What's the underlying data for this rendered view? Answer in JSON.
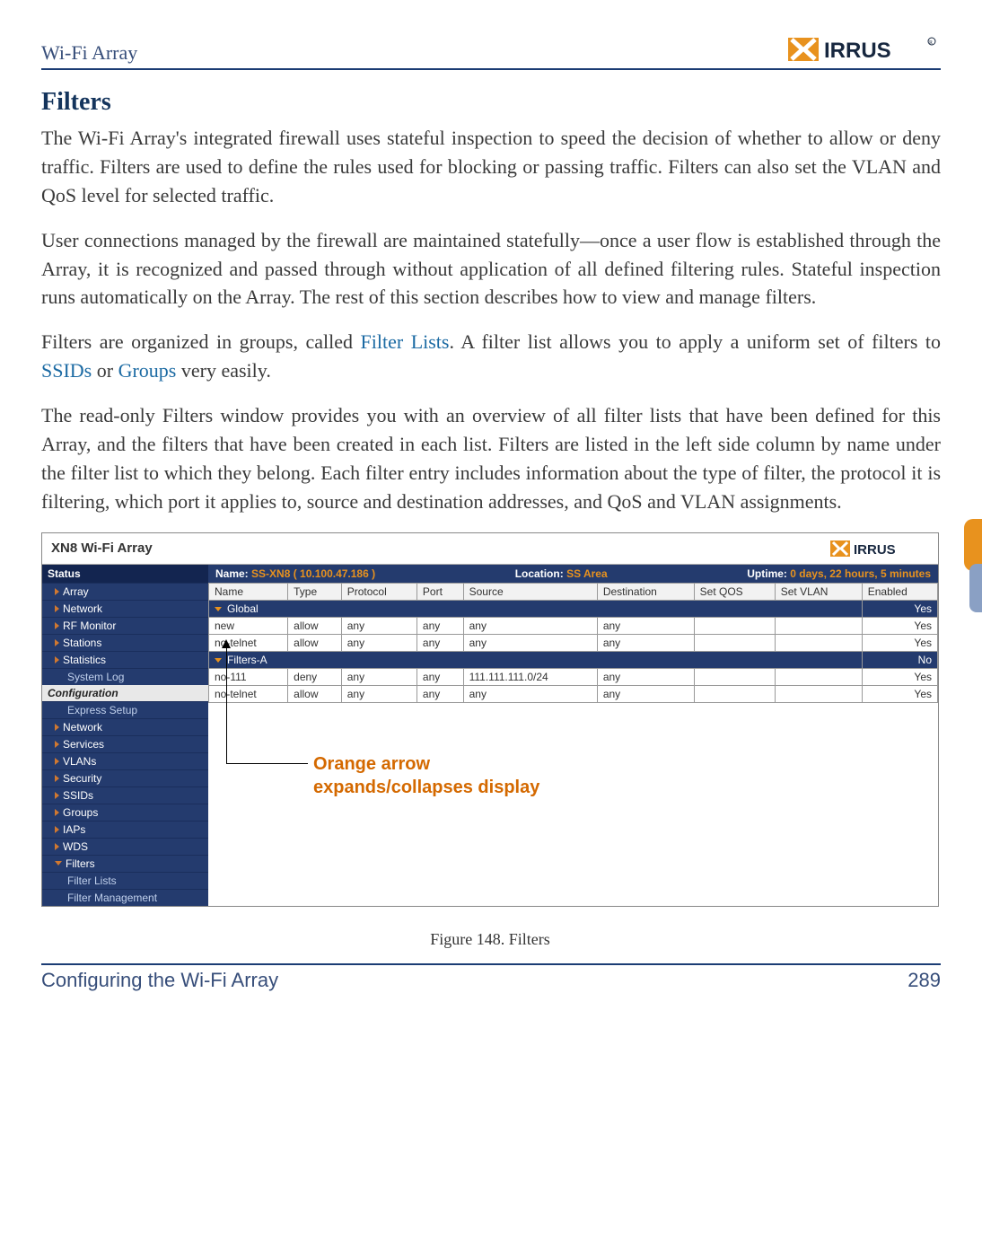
{
  "header": {
    "section": "Wi-Fi Array",
    "logo_text": "XIRRUS"
  },
  "content": {
    "title": "Filters",
    "p1": "The Wi-Fi Array's integrated firewall uses stateful inspection to speed the decision of whether to allow or deny traffic. Filters are used to define the rules used for blocking or passing traffic. Filters can also set the VLAN and QoS level for selected traffic.",
    "p2": "User connections managed by the firewall are maintained statefully—once a user flow is established through the Array, it is recognized and passed through without application of all defined filtering rules. Stateful inspection runs automatically on the Array. The rest of this section describes how to view and manage filters.",
    "p3_a": "Filters are organized in groups, called ",
    "p3_link1": "Filter Lists",
    "p3_b": ". A filter list allows you to apply a uniform set of filters to ",
    "p3_link2": "SSIDs",
    "p3_c": " or ",
    "p3_link3": "Groups",
    "p3_d": " very easily.",
    "p4": "The read-only Filters window provides you with an overview of all filter lists that have been defined for this Array, and the filters that have been created in each list. Filters are listed in the left side column by name under the filter list to which they belong. Each filter entry includes information about the type of filter, the protocol it is filtering, which port it applies to, source and destination addresses, and QoS and VLAN assignments."
  },
  "screenshot": {
    "title": "XN8 Wi-Fi Array",
    "logo": "XIRRUS",
    "sidebar": {
      "status_hdr": "Status",
      "items": [
        {
          "label": "Array",
          "caret": true
        },
        {
          "label": "Network",
          "caret": true
        },
        {
          "label": "RF Monitor",
          "caret": true
        },
        {
          "label": "Stations",
          "caret": true
        },
        {
          "label": "Statistics",
          "caret": true
        },
        {
          "label": "System Log",
          "caret": false,
          "sub": true
        }
      ],
      "conf_hdr": "Configuration",
      "conf_items": [
        {
          "label": "Express Setup",
          "sub": true
        },
        {
          "label": "Network",
          "caret": true
        },
        {
          "label": "Services",
          "caret": true
        },
        {
          "label": "VLANs",
          "caret": true
        },
        {
          "label": "Security",
          "caret": true
        },
        {
          "label": "SSIDs",
          "caret": true
        },
        {
          "label": "Groups",
          "caret": true
        },
        {
          "label": "IAPs",
          "caret": true
        },
        {
          "label": "WDS",
          "caret": true
        },
        {
          "label": "Filters",
          "caret": true,
          "open": true
        },
        {
          "label": "Filter Lists",
          "sub": true
        },
        {
          "label": "Filter Management",
          "sub": true
        }
      ]
    },
    "infobar": {
      "name_lbl": "Name:",
      "name_val": "SS-XN8   ( 10.100.47.186 )",
      "loc_lbl": "Location:",
      "loc_val": "SS Area",
      "up_lbl": "Uptime:",
      "up_val": "0 days, 22 hours, 5 minutes"
    },
    "table": {
      "headers": [
        "Name",
        "Type",
        "Protocol",
        "Port",
        "Source",
        "Destination",
        "Set QOS",
        "Set VLAN",
        "Enabled"
      ],
      "groups": [
        {
          "name": "Global",
          "enabled": "Yes",
          "rows": [
            {
              "name": "new",
              "type": "allow",
              "proto": "any",
              "port": "any",
              "src": "any",
              "dst": "any",
              "qos": "",
              "vlan": "",
              "en": "Yes"
            },
            {
              "name": "no-telnet",
              "type": "allow",
              "proto": "any",
              "port": "any",
              "src": "any",
              "dst": "any",
              "qos": "",
              "vlan": "",
              "en": "Yes"
            }
          ]
        },
        {
          "name": "Filters-A",
          "enabled": "No",
          "rows": [
            {
              "name": "no-111",
              "type": "deny",
              "proto": "any",
              "port": "any",
              "src": "111.111.111.0/24",
              "dst": "any",
              "qos": "",
              "vlan": "",
              "en": "Yes"
            },
            {
              "name": "no-telnet",
              "type": "allow",
              "proto": "any",
              "port": "any",
              "src": "any",
              "dst": "any",
              "qos": "",
              "vlan": "",
              "en": "Yes"
            }
          ]
        }
      ]
    },
    "callout": {
      "line1": "Orange arrow",
      "line2": "expands/collapses display"
    }
  },
  "caption": "Figure 148. Filters",
  "footer": {
    "left": "Configuring the Wi-Fi Array",
    "right": "289"
  }
}
